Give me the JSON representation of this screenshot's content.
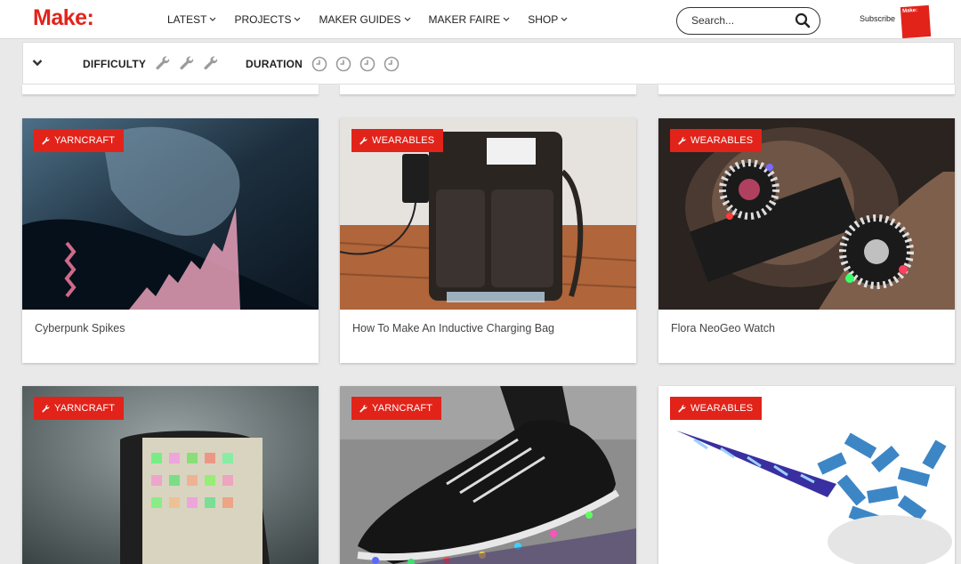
{
  "header": {
    "logo": "Make:",
    "nav": [
      {
        "label": "LATEST"
      },
      {
        "label": "PROJECTS"
      },
      {
        "label": "MAKER GUIDES"
      },
      {
        "label": "MAKER FAIRE"
      },
      {
        "label": "SHOP"
      }
    ],
    "search_placeholder": "Search...",
    "subscribe_label": "Subscribe",
    "magazine_label": "Make:"
  },
  "filters": {
    "difficulty_label": "DIFFICULTY",
    "duration_label": "DURATION",
    "difficulty_levels": 3,
    "duration_levels": 4
  },
  "cards": [
    {
      "category": "YARNCRAFT",
      "title": "Cyberpunk Spikes"
    },
    {
      "category": "WEARABLES",
      "title": "How To Make An Inductive Charging Bag"
    },
    {
      "category": "WEARABLES",
      "title": "Flora NeoGeo Watch"
    },
    {
      "category": "YARNCRAFT",
      "title": ""
    },
    {
      "category": "YARNCRAFT",
      "title": ""
    },
    {
      "category": "WEARABLES",
      "title": ""
    }
  ],
  "colors": {
    "brand": "#e2231a",
    "page_bg": "#e9e9e9"
  }
}
